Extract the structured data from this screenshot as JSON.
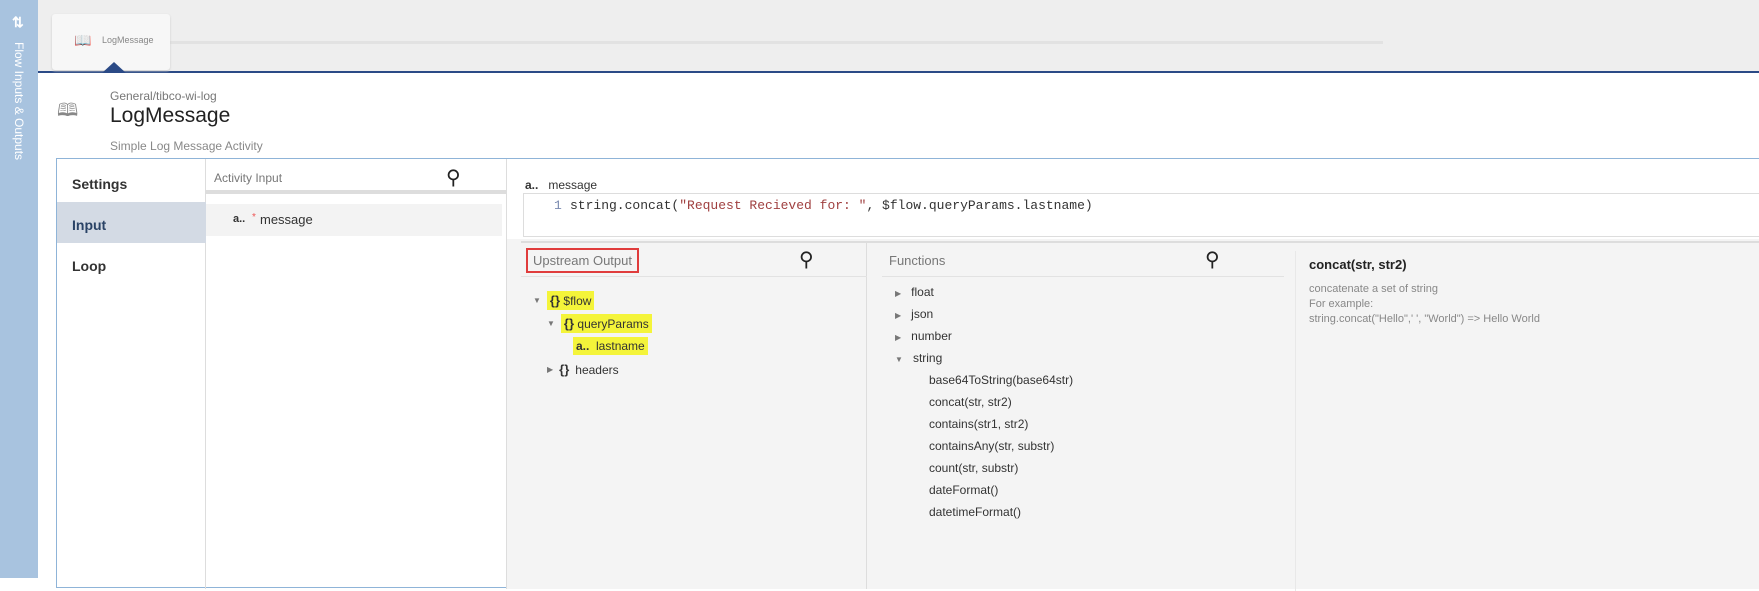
{
  "sidebar": {
    "label": "Flow Inputs & Outputs",
    "icon": "swap-arrows-icon"
  },
  "tab": {
    "label": "LogMessage"
  },
  "header": {
    "breadcrumb": "General/tibco-wi-log",
    "title": "LogMessage",
    "subtitle": "Simple Log Message Activity"
  },
  "nav": [
    "Settings",
    "Input",
    "Loop"
  ],
  "activity_input": {
    "header": "Activity Input",
    "field_type": "a..",
    "required": "*",
    "field": "message"
  },
  "editor": {
    "type": "a..",
    "label": "message",
    "line": "1",
    "code_fn": "string.concat(",
    "code_str": "\"Request Recieved for: \"",
    "code_rest": ", $flow.queryParams.lastname)"
  },
  "upstream": {
    "header": "Upstream Output",
    "tree": [
      {
        "icon": "{}",
        "label": "$flow"
      },
      {
        "icon": "{}",
        "label": "queryParams"
      },
      {
        "icon": "a..",
        "label": "lastname"
      },
      {
        "icon": "{}",
        "label": "headers"
      }
    ]
  },
  "functions": {
    "header": "Functions",
    "groups": [
      "float",
      "json",
      "number",
      "string"
    ],
    "string_items": [
      "base64ToString(base64str)",
      "concat(str, str2)",
      "contains(str1, str2)",
      "containsAny(str, substr)",
      "count(str, substr)",
      "dateFormat()",
      "datetimeFormat()"
    ]
  },
  "description": {
    "title": "concat(str, str2)",
    "line1": "concatenate a set of string",
    "line2": "For example:",
    "line3": "string.concat(\"Hello\",' ', \"World\") => Hello World"
  }
}
